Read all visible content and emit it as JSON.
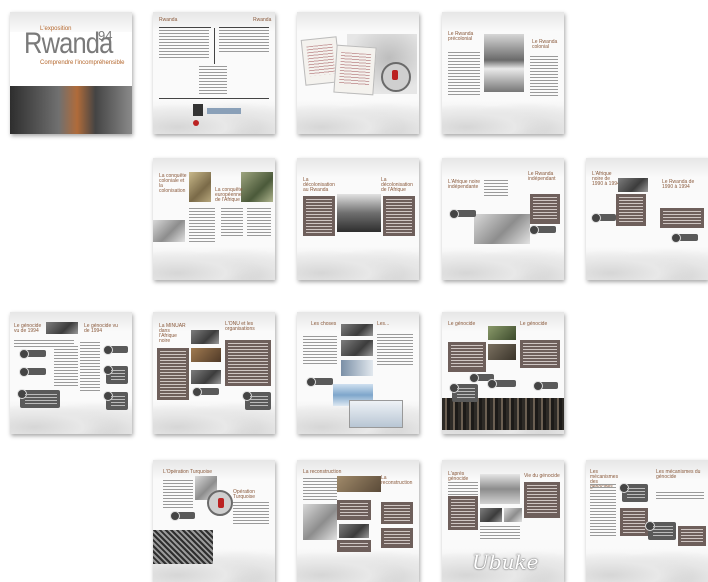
{
  "cover": {
    "exhibition": "L'exposition",
    "title": "Rwanda",
    "year": "94",
    "subtitle": "Comprendre l'incompréhensible"
  },
  "pages": {
    "p2": {
      "title_left": "Rwanda",
      "title_right": "Rwanda"
    },
    "p4": {
      "title": "Le Rwanda précolonial",
      "title_right": "Le Rwanda colonial"
    },
    "p5": {
      "title": "La conquête coloniale et la colonisation",
      "title_right": "La conquête européenne de l'Afrique"
    },
    "p6": {
      "title": "La décolonisation au Rwanda",
      "title_right": "La décolonisation de l'Afrique"
    },
    "p7": {
      "title": "L'Afrique noire indépendante",
      "title_right": "Le Rwanda indépendant"
    },
    "p8": {
      "title": "L'Afrique noire de 1990 à 1994",
      "title_right": "Le Rwanda de 1990 à 1994"
    },
    "p9": {
      "title": "Le génocide vu de 1994",
      "title_right": "Le génocide vu de 1994"
    },
    "p10": {
      "title": "La MINUAR dans l'Afrique noire",
      "title_right": "L'ONU et les organisations"
    },
    "p11": {
      "title": "Les choses",
      "title_right": "Les..."
    },
    "p12": {
      "title": "Le génocide",
      "title_right": "Le génocide"
    },
    "p13": {
      "title": "L'Opération Turquoise",
      "title_right": "Opération Turquoise"
    },
    "p14": {
      "title": "La reconstruction",
      "title_right": "La reconstruction"
    },
    "p15": {
      "title": "L'après génocide",
      "title_right": "Vie du génocide",
      "signature": "Ubuke"
    },
    "p16": {
      "title": "Les mécanismes des génocides",
      "title_right": "Les mécanismes du génocide"
    }
  },
  "icons": [
    "globe-icon",
    "search-icon"
  ],
  "colors": {
    "accent": "#8a5a3c",
    "panel": "#6e5f5b",
    "button": "#5a5a5a"
  }
}
